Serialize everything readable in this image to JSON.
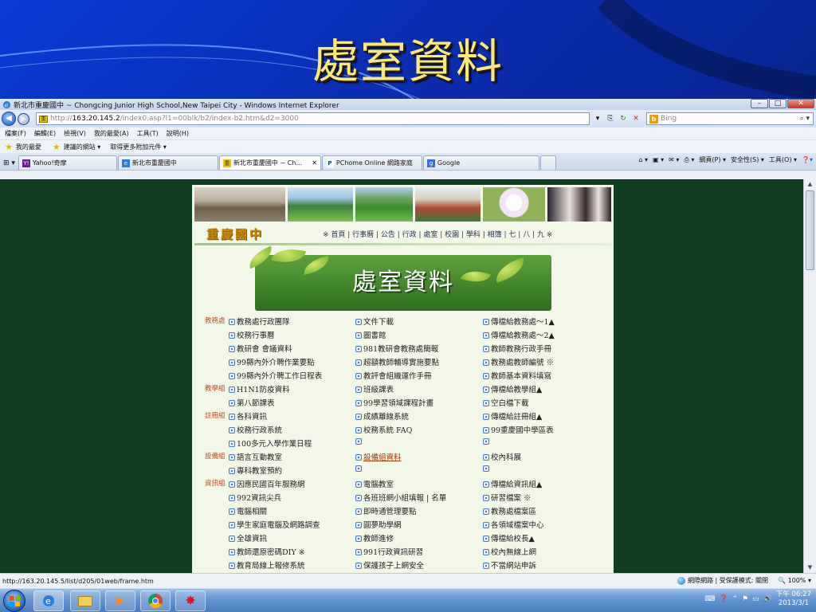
{
  "slide": {
    "title": "處室資料"
  },
  "browser": {
    "window_title": "新北市重慶國中 ~ Chongcing Junior High School,New Taipei City - Windows Internet Explorer",
    "address_prefix": "http://",
    "address_host": "163.20.145.2",
    "address_path": "/index0.asp?l1=00blk/b2/index-b2.htm&d2=3000",
    "search_placeholder": "Bing",
    "menu": [
      "檔案(F)",
      "編輯(E)",
      "檢視(V)",
      "我的最愛(A)",
      "工具(T)",
      "說明(H)"
    ],
    "favorites_bar": {
      "favorites": "我的最愛",
      "suggested": "建議的網站 ▾",
      "more_addons": "取得更多附加元件 ▾"
    },
    "tabs": [
      {
        "label": "Yahoo!奇摩"
      },
      {
        "label": "新北市重慶國中"
      },
      {
        "label": "新北市重慶國中 ~ Ch...",
        "active": true,
        "close": "✕"
      },
      {
        "label": "PChome Online 網路家庭"
      },
      {
        "label": "Google"
      }
    ],
    "commands": {
      "page": "網頁(P) ▾",
      "safety": "安全性(S) ▾",
      "tools": "工具(O) ▾"
    },
    "status_url": "http://163.20.145.5/list/d205/01web/frame.htm",
    "status_zone": "網際網路 | 受保護模式: 關閉",
    "zoom": "100%"
  },
  "site": {
    "school_name": "重慶國中",
    "nav": "※ 首頁 | 行事曆 | 公告 | 行政 | 處室 | 校園 | 學科 | 相簿 | 七 | 八 | 九 ※",
    "banner_title": "處室資料",
    "rows": [
      {
        "dept": "教務處",
        "c1": "教務處行政團隊",
        "c2": "文件下載",
        "c3": "傳檔給教務處～1▲"
      },
      {
        "dept": "",
        "c1": "校務行事曆",
        "c2": "圖書館",
        "c3": "傳檔給教務處～2▲"
      },
      {
        "dept": "",
        "c1": "教研會 會議資料",
        "c2": "981教研會教務處簡報",
        "c3": "教師教務行政手冊"
      },
      {
        "dept": "",
        "c1": "99縣內外介聘作業要點",
        "c2": "超額教師輔導實施要點",
        "c3": "教務處教師編號 ※"
      },
      {
        "dept": "",
        "c1": "99縣內外介聘工作日程表",
        "c2": "教評會組織運作手冊",
        "c3": "教師基本資料填寫"
      },
      {
        "dept": "教學組",
        "c1": "H1N1防疫資料",
        "c2": "班級課表",
        "c3": "傳檔給教學組▲"
      },
      {
        "dept": "",
        "c1": "第八節課表",
        "c2": "99學習領域課程計畫",
        "c3": "空白檔下載"
      },
      {
        "dept": "註冊組",
        "c1": "各科資訊",
        "c2": "成績離線系統",
        "c3": "傳檔給註冊組▲"
      },
      {
        "dept": "",
        "c1": "校務行政系統",
        "c2": "校務系統 FAQ",
        "c3": "99重慶國中學區表"
      },
      {
        "dept": "",
        "c1": "100多元入學作業日程",
        "c2": "",
        "c3": ""
      },
      {
        "dept": "設備組",
        "c1": "語言互動教室",
        "c2": "設備組資料",
        "c2_link": true,
        "c3": "校內科展"
      },
      {
        "dept": "",
        "c1": "專科教室預約",
        "c2": "",
        "c3": ""
      },
      {
        "dept": "資訊組",
        "c1": "因應民國百年服務網",
        "c2": "電腦教室",
        "c3": "傳檔給資訊組▲"
      },
      {
        "dept": "",
        "c1": "992資訊尖兵",
        "c2": "各班班網小組填報 | 名單",
        "c3": "研習檔案 ※"
      },
      {
        "dept": "",
        "c1": "電腦相關",
        "c2": "即時通管理要點",
        "c3": "教務處檔案區"
      },
      {
        "dept": "",
        "c1": "學生家庭電腦及網路調查",
        "c2": "圓夢助學網",
        "c3": "各領域檔案中心"
      },
      {
        "dept": "",
        "c1": "全雄資訊",
        "c2": "教師進修",
        "c3": "傳檔給校長▲"
      },
      {
        "dept": "",
        "c1": "教師還原密碼DIY ※",
        "c2": "991行政資訊研習",
        "c3": "校內無線上網"
      },
      {
        "dept": "",
        "c1": "教育局線上報修系統",
        "c2": "保護孩子上網安全",
        "c3": "不當網站申訴"
      }
    ]
  },
  "taskbar": {
    "time": "下午 06:27",
    "date": "2013/3/1"
  },
  "colors": {
    "slide_blue": "#0a2ba8",
    "title_gold": "#f7ea7a",
    "page_bg": "#0f3f23"
  }
}
